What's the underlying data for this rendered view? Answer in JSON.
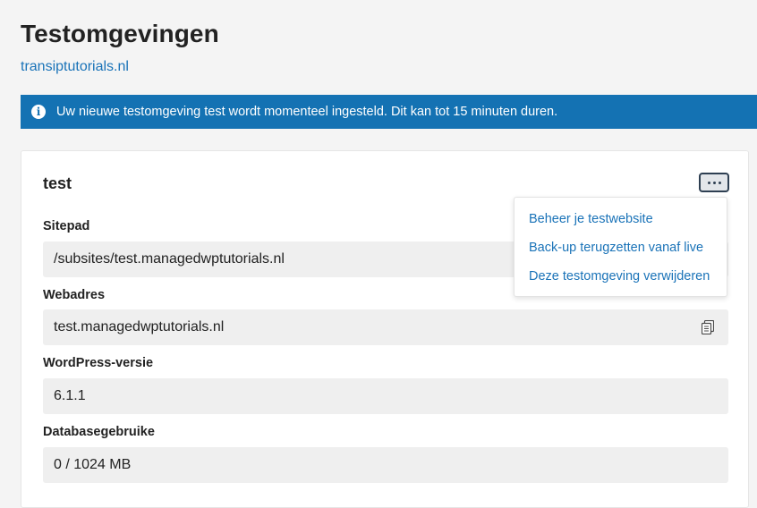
{
  "header": {
    "title": "Testomgevingen",
    "domain": "transiptutorials.nl"
  },
  "notice": {
    "icon": "info-icon",
    "text": "Uw nieuwe testomgeving test wordt momenteel ingesteld. Dit kan tot 15 minuten duren.",
    "color": "#1472b3"
  },
  "card": {
    "title": "test",
    "more_icon": "more-horizontal-icon",
    "fields": [
      {
        "label": "Sitepad",
        "value": "/subsites/test.managedwptutorials.nl"
      },
      {
        "label": "Webadres",
        "value": "test.managedwptutorials.nl",
        "action_icon": "copy-icon"
      },
      {
        "label": "WordPress-versie",
        "value": "6.1.1"
      },
      {
        "label": "Databasegebruike",
        "value": "0 / 1024 MB"
      }
    ]
  },
  "menu": {
    "items": [
      "Beheer je testwebsite",
      "Back-up terugzetten vanaf live",
      "Deze testomgeving verwijderen"
    ],
    "link_color": "#1a73b8"
  }
}
